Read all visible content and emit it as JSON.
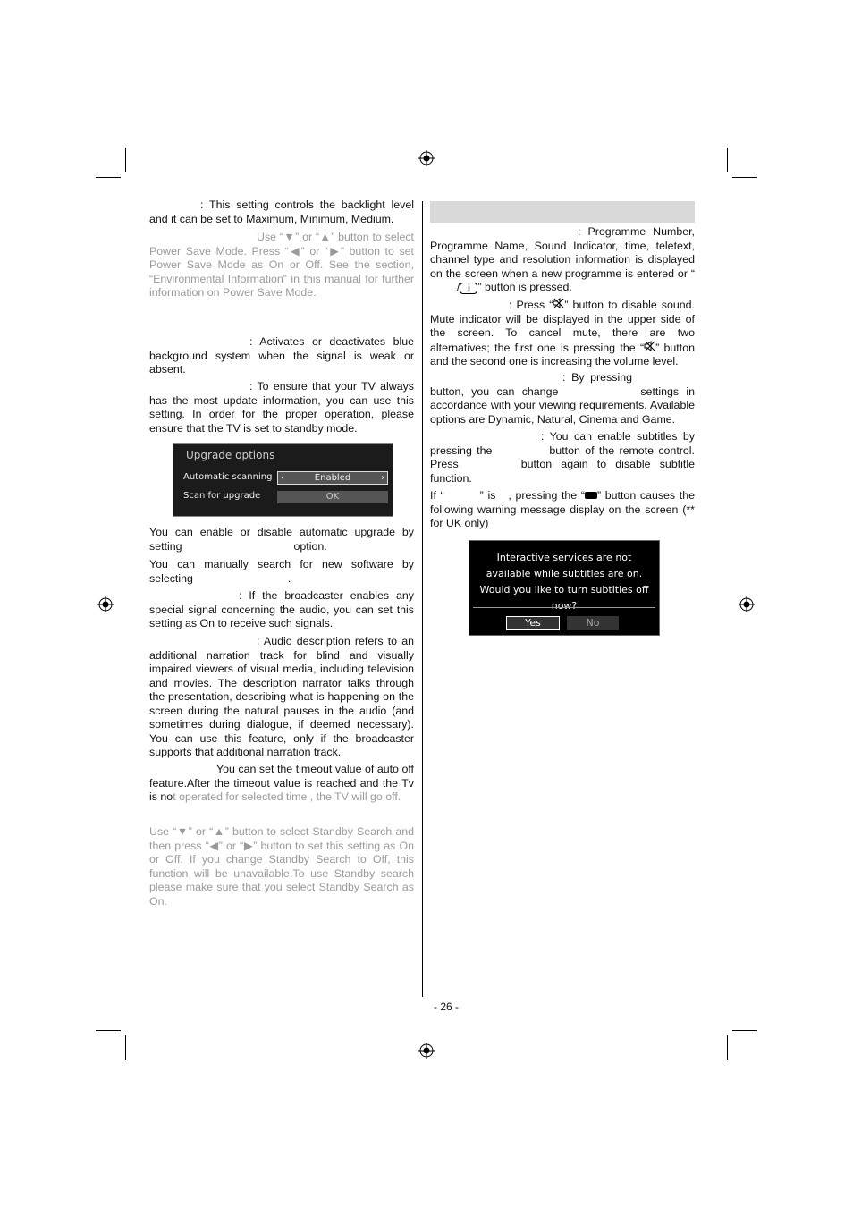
{
  "left": {
    "backlight": ": This setting controls the backlight level and it can be set to Maximum, Minimum, Medium.",
    "power_save": "Use “▼” or “▲” button to select Power Save Mode. Press “◀” or “▶” button to set Power Save Mode as On or Off. See the section, “Environmental Information” in this manual for further information on Power Save Mode.",
    "blue_bg": ": Activates or deactivates blue background system when the signal is weak or absent.",
    "ota": ": To ensure that your TV always has the most update information, you can use this setting. In order for the proper operation, please ensure that the TV is set to standby mode.",
    "auto_upgrade_a": "You can enable or disable automatic upgrade by setting",
    "auto_upgrade_b": "option.",
    "manual_a": "You can manually search for new software by selecting",
    "manual_b": ".",
    "hoh": ": If the broadcaster enables any special signal concerning the audio, you can set this setting as On to receive such signals.",
    "audio_desc": ": Audio description refers to an additional narration track for blind and visually impaired viewers of visual media, including television and movies. The description narrator talks through the presentation, describing what is happening on the screen during the natural pauses in the audio (and sometimes during dialogue, if deemed necessary). You can use this feature, only if the broadcaster supports that additional narration track.",
    "auto_off_a": "You can set the timeout value of auto off feature.After the timeout value is reached and the Tv is no",
    "auto_off_b": "t operated for selected time , the TV will go off.",
    "standby": "Use “▼” or “▲” button to select Standby Search and then press “◀” or “▶” button to set this setting as On or Off. If you change Standby Search to Off, this function will be unavailable.To use Standby search please make sure that you select Standby Search as On."
  },
  "upgrade_menu": {
    "title": "Upgrade options",
    "rows": [
      {
        "label": "Automatic scanning",
        "value": "Enabled"
      },
      {
        "label": "Scan for upgrade",
        "value": "OK"
      }
    ]
  },
  "right": {
    "info_a": ": Programme Number, Programme Name, Sound Indicator, time, teletext, channel type and resolution information is displayed on the screen when a new programme is entered or “",
    "info_b": "/",
    "info_c": "” button is pressed.",
    "mute_a": ": Press “",
    "mute_b": "” button to disable sound. Mute indicator will be displayed in the upper side of the screen. To cancel mute, there are two alternatives; the first one is pressing the “",
    "mute_c": "” button and the second one is increasing the volume level.",
    "pic_a": ": By pressing",
    "pic_b": "button, you can change",
    "pic_c": "settings in accordance with your viewing requirements. Available options are Dynamic, Natural, Cinema and Game.",
    "sub_a": ": You can enable subtitles by pressing the",
    "sub_b": "button of the remote control. Press",
    "sub_c": "button again to disable subtitle function.",
    "warn_a": "If “",
    "warn_b": "” is",
    "warn_c": ", pressing the “",
    "warn_d": "” button causes the following warning message display on the screen (** for UK only)"
  },
  "dialog": {
    "message": "Interactive services are not available while subtitles are on. Would you like to turn subtitles off now?",
    "yes": "Yes",
    "no": "No"
  },
  "page_number": "- 26 -",
  "colors": {
    "header_bar": "#d9d9d9",
    "gray_text": "#9a9a9a"
  }
}
